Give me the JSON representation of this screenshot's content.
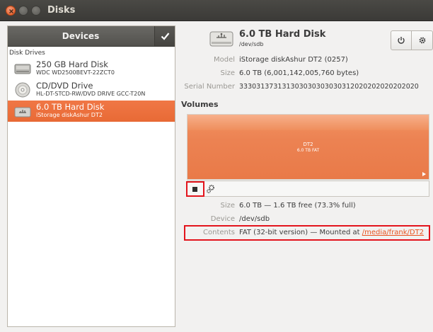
{
  "window": {
    "title": "Disks"
  },
  "sidebar": {
    "header": "Devices",
    "section": "Disk Drives",
    "drives": [
      {
        "name": "250 GB Hard Disk",
        "sub": "WDC WD2500BEVT-22ZCT0",
        "icon": "hard-disk-icon",
        "selected": false
      },
      {
        "name": "CD/DVD Drive",
        "sub": "HL-DT-STCD-RW/DVD DRIVE GCC-T20N",
        "icon": "optical-disc-icon",
        "selected": false
      },
      {
        "name": "6.0 TB Hard Disk",
        "sub": "iStorage diskAshur DT2",
        "icon": "usb-drive-icon",
        "selected": true
      }
    ]
  },
  "disk": {
    "title": "6.0 TB Hard Disk",
    "path": "/dev/sdb",
    "model_label": "Model",
    "model": "iStorage diskAshur DT2 (0257)",
    "size_label": "Size",
    "size": "6.0 TB (6,001,142,005,760 bytes)",
    "serial_label": "Serial Number",
    "serial": "333031373131303030303030312020202020202020"
  },
  "volumes": {
    "label": "Volumes",
    "partition": {
      "name": "DT2",
      "size": "6.0 TB FAT"
    },
    "size_label": "Size",
    "size": "6.0 TB — 1.6 TB free (73.3% full)",
    "device_label": "Device",
    "device": "/dev/sdb",
    "contents_label": "Contents",
    "contents_prefix": "FAT (32-bit version) — Mounted at ",
    "mount_point": "/media/frank/DT2"
  },
  "colors": {
    "accent": "#e95420",
    "selection": "#ef7240",
    "highlight_box": "#e3141c"
  }
}
